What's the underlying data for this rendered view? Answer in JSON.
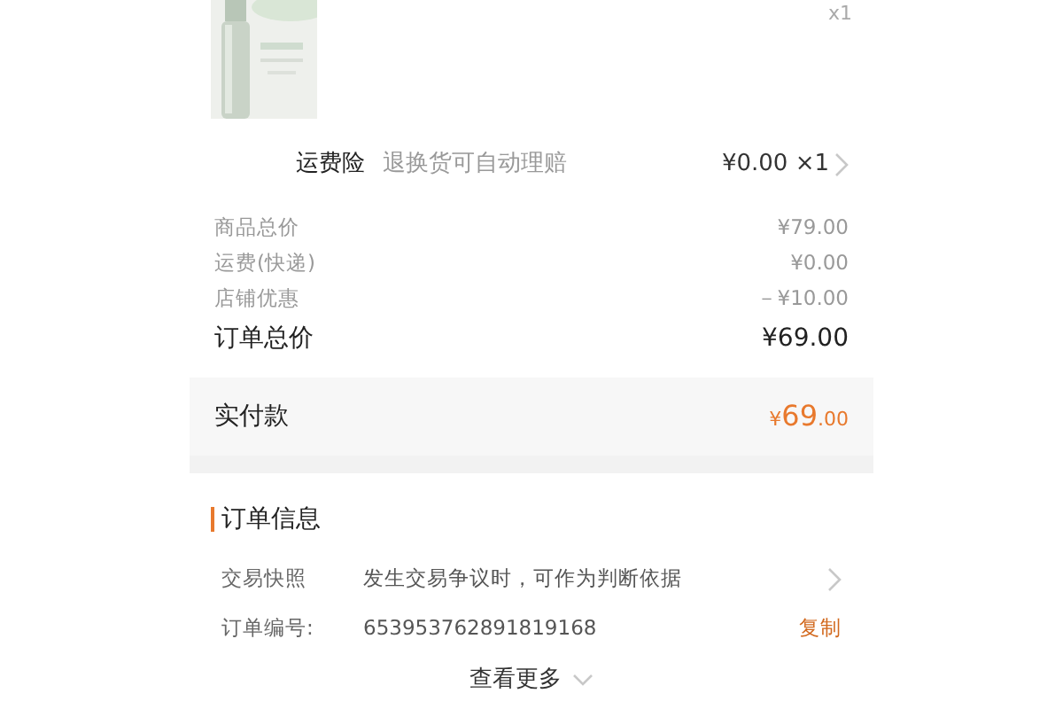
{
  "product": {
    "quantity": "x1"
  },
  "insurance": {
    "label": "运费险",
    "description": "退换货可自动理赔",
    "price": "¥0.00 ×1"
  },
  "costs": [
    {
      "label": "商品总价",
      "value": "¥79.00"
    },
    {
      "label": "运费(快递)",
      "value": "¥0.00"
    },
    {
      "label": "店铺优惠",
      "value": "－¥10.00"
    }
  ],
  "order_total": {
    "label": "订单总价",
    "value": "¥69.00"
  },
  "paid": {
    "label": "实付款",
    "currency": "¥",
    "integer": "69",
    "decimals": ".00"
  },
  "order_info": {
    "title": "订单信息",
    "rows": [
      {
        "kind": "link",
        "label": "交易快照",
        "value": "发生交易争议时，可作为判断依据"
      },
      {
        "kind": "copy",
        "label": "订单编号:",
        "value": "653953762891819168",
        "action": "复制"
      }
    ]
  },
  "more": {
    "label": "查看更多"
  }
}
